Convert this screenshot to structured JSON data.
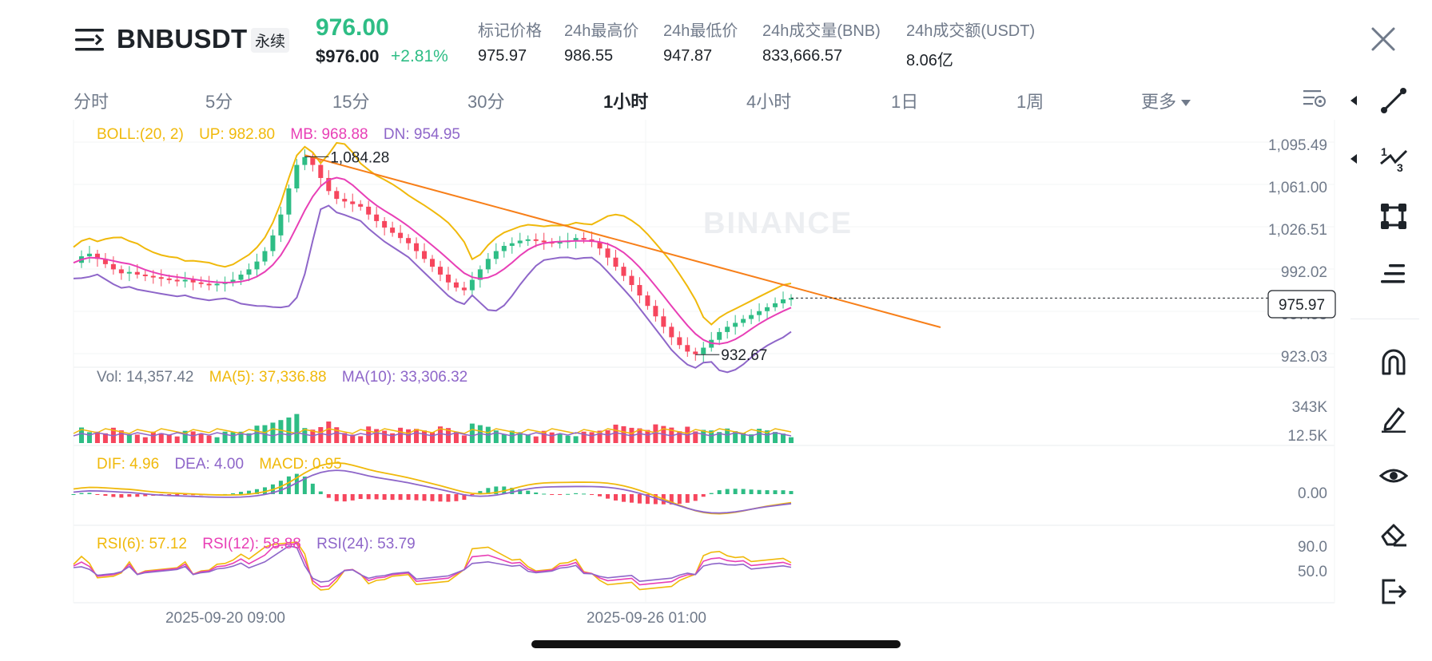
{
  "header": {
    "symbol": "BNBUSDT",
    "contract_type": "永续",
    "last_price": "976.00",
    "usd_price": "$976.00",
    "change_percent": "+2.81%",
    "stats": [
      {
        "label": "标记价格",
        "value": "975.97"
      },
      {
        "label": "24h最高价",
        "value": "986.55"
      },
      {
        "label": "24h最低价",
        "value": "947.87"
      },
      {
        "label": "24h成交量(BNB)",
        "value": "833,666.57"
      },
      {
        "label": "24h成交额(USDT)",
        "value": "8.06亿"
      }
    ]
  },
  "intervals": [
    {
      "label": "分时",
      "active": false
    },
    {
      "label": "5分",
      "active": false
    },
    {
      "label": "15分",
      "active": false
    },
    {
      "label": "30分",
      "active": false
    },
    {
      "label": "1小时",
      "active": true
    },
    {
      "label": "4小时",
      "active": false
    },
    {
      "label": "1日",
      "active": false
    },
    {
      "label": "1周",
      "active": false
    },
    {
      "label": "更多",
      "active": false
    }
  ],
  "icons": {
    "menu": "menu-lines-icon",
    "close": "close-icon",
    "settings": "indicator-settings-icon",
    "tools": [
      "trend-line-icon",
      "fibonacci-icon",
      "rectangle-shape-icon",
      "text-lines-icon",
      "magnet-icon",
      "pencil-icon",
      "eye-icon",
      "eraser-icon",
      "exit-icon"
    ]
  },
  "colors": {
    "up": "#2ebd85",
    "down": "#f6465d",
    "boll_up": "#f0b90b",
    "boll_mb": "#e83fb6",
    "boll_dn": "#8e66c9",
    "trend_line": "#f77f19"
  },
  "chart_data": {
    "type": "candlestick",
    "watermark": "BINANCE",
    "price_axis": [
      "1,095.49",
      "1,061.00",
      "1,026.51",
      "992.02",
      "957.53",
      "923.03"
    ],
    "current_price_label": "975.97",
    "high_marker": "1,084.28",
    "low_marker": "932.67",
    "time_labels": [
      "2025-09-20 09:00",
      "2025-09-26 01:00"
    ],
    "boll": {
      "title": "BOLL:(20, 2)",
      "up": "UP: 982.80",
      "mb": "MB: 968.88",
      "dn": "DN: 954.95"
    },
    "volume": {
      "vol": "Vol: 14,357.42",
      "ma5": "MA(5): 37,336.88",
      "ma10": "MA(10): 33,306.32",
      "axis": [
        "343K",
        "12.5K"
      ]
    },
    "macd": {
      "dif": "DIF: 4.96",
      "dea": "DEA: 4.00",
      "macd": "MACD: 0.95",
      "axis": [
        "0.00"
      ]
    },
    "rsi": {
      "rsi6": "RSI(6): 57.12",
      "rsi12": "RSI(12): 58.88",
      "rsi24": "RSI(24): 53.79",
      "axis": [
        "90.0",
        "50.0"
      ]
    },
    "price_series": [
      1003,
      1008,
      1010,
      1006,
      1002,
      998,
      995,
      996,
      994,
      993,
      992,
      991,
      990,
      989,
      990,
      988,
      987,
      986,
      987,
      988,
      990,
      994,
      998,
      1004,
      1012,
      1024,
      1040,
      1060,
      1078,
      1084,
      1078,
      1068,
      1058,
      1052,
      1050,
      1048,
      1046,
      1040,
      1035,
      1030,
      1026,
      1022,
      1018,
      1012,
      1006,
      1000,
      994,
      988,
      984,
      982,
      990,
      998,
      1006,
      1012,
      1016,
      1018,
      1020,
      1021,
      1020,
      1019,
      1018,
      1019,
      1020,
      1022,
      1021,
      1019,
      1014,
      1007,
      1000,
      993,
      986,
      978,
      970,
      962,
      954,
      946,
      940,
      935,
      933,
      938,
      944,
      950,
      954,
      957,
      960,
      963,
      966,
      969,
      972,
      975,
      976
    ],
    "low_index": 78,
    "high_index": 29
  }
}
